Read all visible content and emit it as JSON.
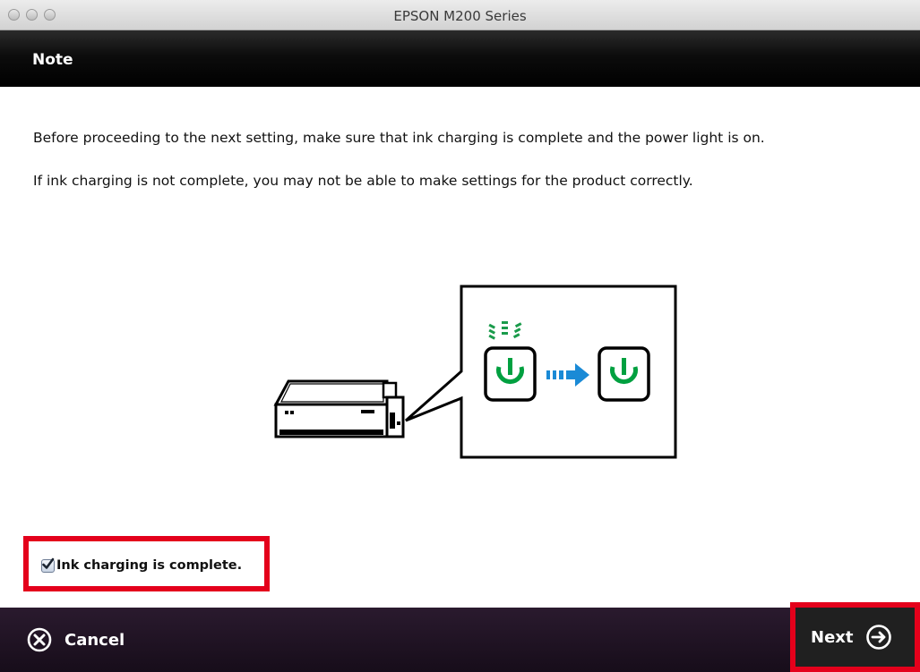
{
  "window": {
    "title": "EPSON M200 Series"
  },
  "header": {
    "title": "Note"
  },
  "content": {
    "line1": "Before proceeding to the next setting, make sure that ink charging is complete and the power light is on.",
    "line2": "If ink charging is not complete, you may not be able to make settings for the product correctly."
  },
  "checkbox": {
    "label": "Ink charging is complete.",
    "checked": true
  },
  "footer": {
    "cancel_label": "Cancel",
    "next_label": "Next"
  },
  "colors": {
    "power_green": "#00a040",
    "arrow_blue": "#1a8ad6",
    "highlight_red": "#e4001b"
  }
}
